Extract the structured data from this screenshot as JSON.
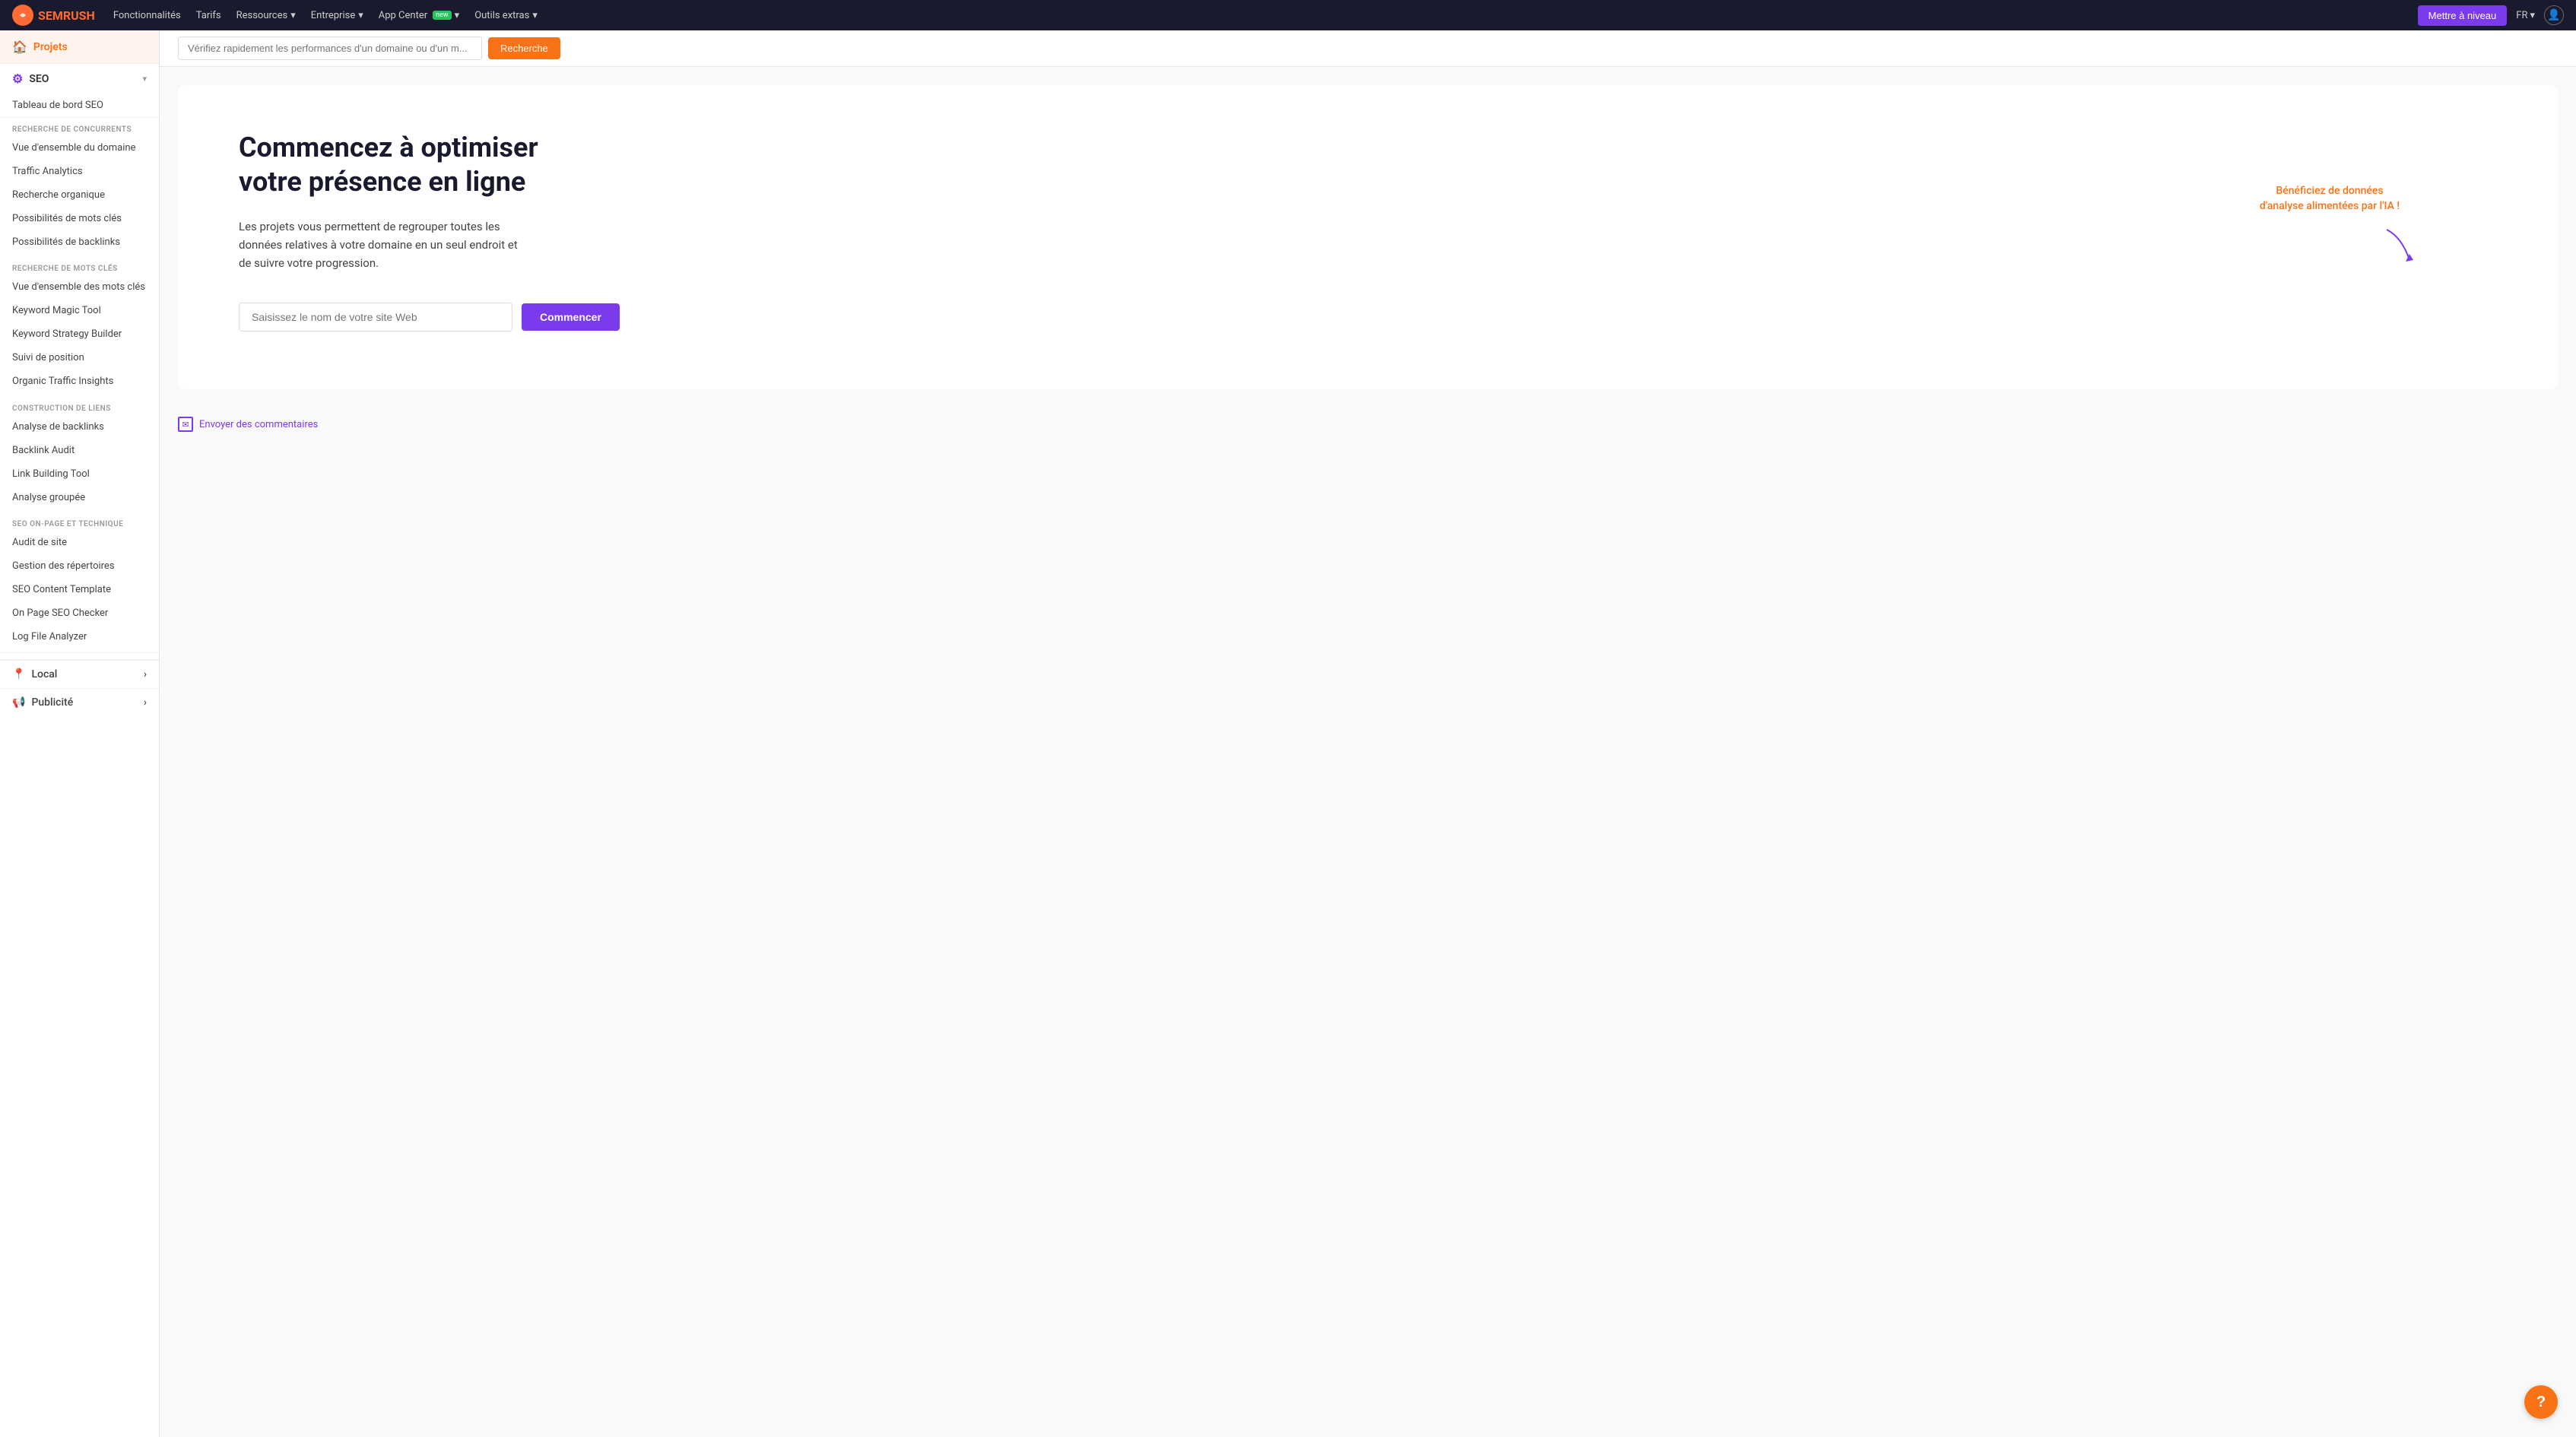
{
  "topnav": {
    "logo_text": "SEMRUSH",
    "links": [
      {
        "label": "Fonctionnalités",
        "has_dropdown": false
      },
      {
        "label": "Tarifs",
        "has_dropdown": false
      },
      {
        "label": "Ressources",
        "has_dropdown": true
      },
      {
        "label": "Entreprise",
        "has_dropdown": true
      },
      {
        "label": "App Center",
        "has_dropdown": true,
        "badge": "new"
      },
      {
        "label": "Outils extras",
        "has_dropdown": true
      }
    ],
    "upgrade_label": "Mettre à niveau",
    "lang": "FR",
    "user_icon": "👤"
  },
  "search": {
    "placeholder": "Vérifiez rapidement les performances d'un domaine ou d'un m...",
    "button_label": "Recherche"
  },
  "sidebar": {
    "projets_label": "Projets",
    "seo_label": "SEO",
    "tableau_bord_label": "Tableau de bord SEO",
    "sections": [
      {
        "header": "RECHERCHE DE CONCURRENTS",
        "items": [
          "Vue d'ensemble du domaine",
          "Traffic Analytics",
          "Recherche organique",
          "Possibilités de mots clés",
          "Possibilités de backlinks"
        ]
      },
      {
        "header": "RECHERCHE DE MOTS CLÉS",
        "items": [
          "Vue d'ensemble des mots clés",
          "Keyword Magic Tool",
          "Keyword Strategy Builder",
          "Suivi de position",
          "Organic Traffic Insights"
        ]
      },
      {
        "header": "CONSTRUCTION DE LIENS",
        "items": [
          "Analyse de backlinks",
          "Backlink Audit",
          "Link Building Tool",
          "Analyse groupée"
        ]
      },
      {
        "header": "SEO ON-PAGE ET TECHNIQUE",
        "items": [
          "Audit de site",
          "Gestion des répertoires",
          "SEO Content Template",
          "On Page SEO Checker",
          "Log File Analyzer"
        ]
      }
    ],
    "bottom_items": [
      {
        "label": "Local",
        "has_arrow": true
      },
      {
        "label": "Publicité",
        "has_arrow": true
      }
    ]
  },
  "hero": {
    "title": "Commencez à optimiser votre présence en ligne",
    "description": "Les projets vous permettent de regrouper toutes les données relatives à votre domaine en un seul endroit et de suivre votre progression.",
    "ai_callout": "Bénéficiez de données d'analyse alimentées par l'IA !",
    "site_input_placeholder": "Saisissez le nom de votre site Web",
    "start_button_label": "Commencer"
  },
  "feedback": {
    "link_label": "Envoyer des commentaires"
  },
  "help": {
    "label": "?"
  }
}
